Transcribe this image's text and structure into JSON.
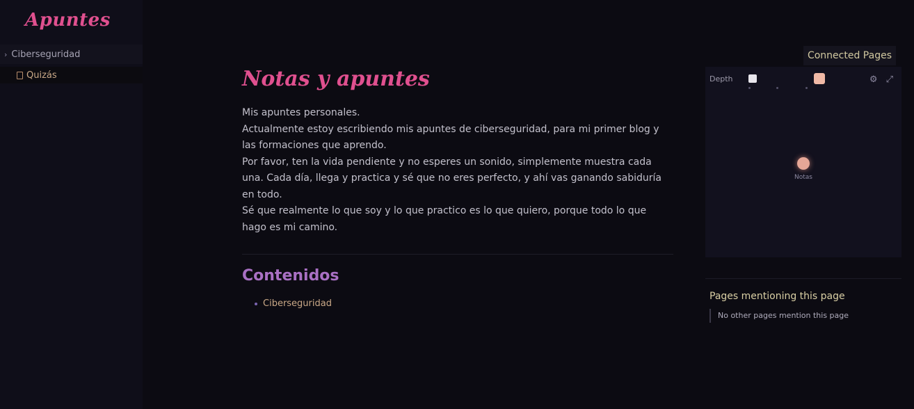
{
  "sidebar": {
    "site_title": "Apuntes",
    "section_label": "Ciberseguridad",
    "item_label": "Quizás"
  },
  "main": {
    "title": "Notas y apuntes",
    "paragraphs": [
      "Mis apuntes personales.",
      "Actualmente estoy escribiendo mis apuntes de ciberseguridad, para mi primer blog y las formaciones que aprendo.",
      "Por favor, ten la vida pendiente y no esperes un sonido, simplemente muestra cada una. Cada día, llega y practica y sé que no eres perfecto, y ahí vas ganando sabiduría en todo.",
      "Sé que realmente lo que soy y lo que practico es lo que quiero, porque todo lo que hago es mi camino."
    ],
    "contents_heading": "Contenidos",
    "contents_items": [
      "Ciberseguridad"
    ]
  },
  "right": {
    "graph_header": "Connected Pages",
    "depth_label": "Depth",
    "controls": "⚙ ⤢",
    "node_label": "Notas",
    "backlinks_title": "Pages mentioning this page",
    "backlinks_empty": "No other pages mention this page"
  },
  "colors": {
    "accent_title": "#e0508f",
    "heading": "#a970c4",
    "link": "#c9a887",
    "node": "#e6a797"
  }
}
